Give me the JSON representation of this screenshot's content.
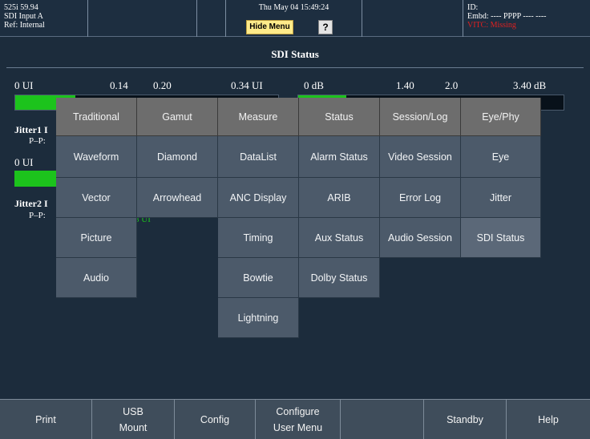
{
  "status_bar": {
    "format": "525i 59.94",
    "input": "SDI Input A",
    "ref": "Ref: Internal",
    "datetime": "Thu May 04 15:49:24",
    "hide_menu_label": "Hide Menu",
    "help_q_label": "?",
    "id_label": "ID:",
    "embd_label": "Embd: ---- PPPP ---- ----",
    "vitc_label": "VITC: Missing",
    "colors": {
      "vitc_missing": "#e02020",
      "hide_menu_bg": "#ffeb8a"
    }
  },
  "page_title": "SDI Status",
  "background_readouts": {
    "ui_scale": [
      "0 UI",
      "0.14",
      "0.20",
      "0.34 UI"
    ],
    "db_scale": [
      "0 dB",
      "1.40",
      "2.0",
      "3.40 dB"
    ],
    "jitter1_label": "Jitter1 I",
    "pp1_label": "P–P:",
    "ui_row2_label": "0 UI",
    "jitter2_label": "Jitter2 I",
    "pp2_label": "P–P:",
    "green_partial": "8 UI",
    "bar_color": "#1cc31c"
  },
  "menu": {
    "headers": [
      "Traditional",
      "Gamut",
      "Measure",
      "Status",
      "Session/Log",
      "Eye/Phy"
    ],
    "columns": [
      [
        "Waveform",
        "Vector",
        "Picture",
        "Audio"
      ],
      [
        "Diamond",
        "Arrowhead"
      ],
      [
        "DataList",
        "ANC Display",
        "Timing",
        "Bowtie",
        "Lightning"
      ],
      [
        "Alarm Status",
        "ARIB",
        "Aux Status",
        "Dolby Status"
      ],
      [
        "Video Session",
        "Error Log",
        "Audio Session"
      ],
      [
        "Eye",
        "Jitter",
        "SDI Status"
      ]
    ],
    "selected": "SDI Status"
  },
  "softkeys": {
    "print": "Print",
    "usb_line1": "USB",
    "usb_line2": "Mount",
    "config": "Config",
    "configure_line1": "Configure",
    "configure_line2": "User Menu",
    "blank1": "",
    "blank2": "",
    "standby": "Standby",
    "help": "Help"
  }
}
